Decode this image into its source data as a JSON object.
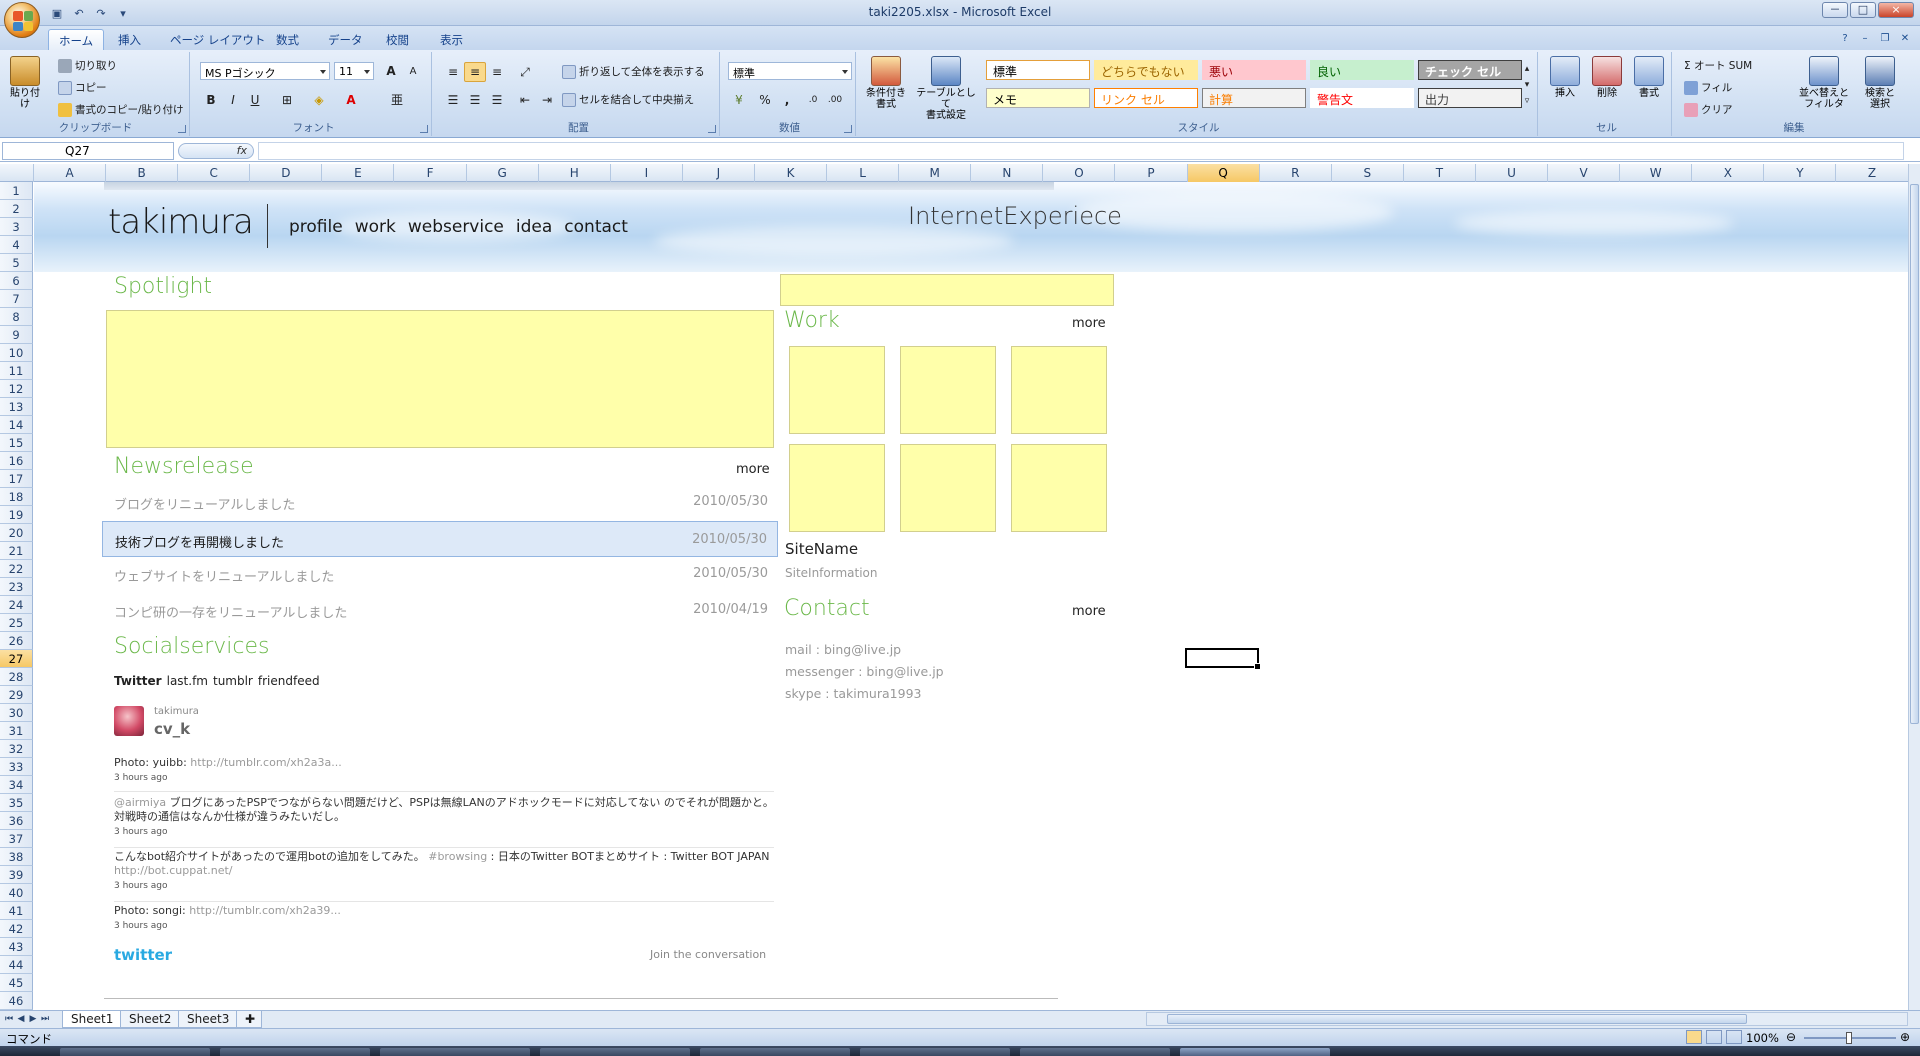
{
  "window": {
    "title": "taki2205.xlsx - Microsoft Excel",
    "controls": [
      "－",
      "□",
      "×"
    ]
  },
  "qat": {
    "save_icon": "save-icon",
    "undo_icon": "undo-icon",
    "redo_icon": "redo-icon"
  },
  "ribbon_tabs": [
    "ホーム",
    "挿入",
    "ページ レイアウト",
    "数式",
    "データ",
    "校閲",
    "表示"
  ],
  "ribbon": {
    "clipboard": {
      "label": "クリップボード",
      "paste": "貼り付け",
      "cut": "切り取り",
      "copy": "コピー",
      "format_painter": "書式のコピー/貼り付け"
    },
    "font": {
      "label": "フォント",
      "font_name": "MS Pゴシック",
      "font_size": "11",
      "bold": "B",
      "italic": "I",
      "underline": "U",
      "grow": "A",
      "shrink": "A",
      "color_letter": "A"
    },
    "alignment": {
      "label": "配置",
      "wrap": "折り返して全体を表示する",
      "merge": "セルを結合して中央揃え"
    },
    "number": {
      "label": "数値",
      "format": "標準",
      "percent": "%",
      "comma": ","
    },
    "styles": {
      "label": "スタイル",
      "conditional": "条件付き\n書式",
      "table": "テーブルとして\n書式設定",
      "cells": [
        {
          "text": "標準",
          "bg": "#ffffff",
          "fg": "#000000",
          "border": "#e49f3a"
        },
        {
          "text": "どちらでもない",
          "bg": "#ffeb9c",
          "fg": "#9c6500",
          "border": "#ffeb9c"
        },
        {
          "text": "悪い",
          "bg": "#ffc7ce",
          "fg": "#9c0006",
          "border": "#ffc7ce"
        },
        {
          "text": "良い",
          "bg": "#c6efce",
          "fg": "#006100",
          "border": "#c6efce"
        },
        {
          "text": "チェック セル",
          "bg": "#a5a5a5",
          "fg": "#ffffff",
          "border": "#3f3f3f"
        },
        {
          "text": "メモ",
          "bg": "#ffffcc",
          "fg": "#000000",
          "border": "#b2b2b2"
        },
        {
          "text": "リンク セル",
          "bg": "#ffffff",
          "fg": "#fa7d00",
          "border": "#ff8001"
        },
        {
          "text": "計算",
          "bg": "#f2f2f2",
          "fg": "#fa7d00",
          "border": "#7f7f7f"
        },
        {
          "text": "警告文",
          "bg": "#ffffff",
          "fg": "#ff0000",
          "border": "#ffffff"
        },
        {
          "text": "出力",
          "bg": "#f2f2f2",
          "fg": "#3f3f3f",
          "border": "#3f3f3f"
        }
      ]
    },
    "cells": {
      "label": "セル",
      "insert": "挿入",
      "delete": "削除",
      "format": "書式"
    },
    "editing": {
      "label": "編集",
      "autosum": "Σ オート SUM",
      "fill": "フィル",
      "clear": "クリア",
      "sort": "並べ替えと\nフィルタ",
      "find": "検索と\n選択"
    }
  },
  "formula_bar": {
    "name_box": "Q27",
    "fx": "fx",
    "value": ""
  },
  "columns": [
    "A",
    "B",
    "C",
    "D",
    "E",
    "F",
    "G",
    "H",
    "I",
    "J",
    "K",
    "L",
    "M",
    "N",
    "O",
    "P",
    "Q",
    "R",
    "S",
    "T",
    "U",
    "V",
    "W",
    "X",
    "Y",
    "Z"
  ],
  "selected_column": "Q",
  "rows": [
    "1",
    "2",
    "3",
    "4",
    "5",
    "6",
    "7",
    "8",
    "9",
    "10",
    "11",
    "12",
    "13",
    "14",
    "15",
    "16",
    "17",
    "18",
    "19",
    "20",
    "21",
    "22",
    "23",
    "24",
    "25",
    "26",
    "27",
    "28",
    "29",
    "30",
    "31",
    "32",
    "33",
    "34",
    "35",
    "36",
    "37",
    "38",
    "39",
    "40",
    "41",
    "42",
    "43",
    "44",
    "45",
    "46"
  ],
  "selected_row": "27",
  "site": {
    "logo": "takimura",
    "nav": [
      "profile",
      "work",
      "webservice",
      "idea",
      "contact"
    ],
    "header_right": "InternetExperiece",
    "spotlight": {
      "title": "Spotlight"
    },
    "newsrelease": {
      "title": "Newsrelease",
      "more": "more",
      "items": [
        {
          "title": "ブログをリニューアルしました",
          "date": "2010/05/30"
        },
        {
          "title": "技術ブログを再開機しました",
          "date": "2010/05/30"
        },
        {
          "title": "ウェブサイトをリニューアルしました",
          "date": "2010/05/30"
        },
        {
          "title": "コンピ研の一存をリニューアルしました",
          "date": "2010/04/19"
        }
      ]
    },
    "social": {
      "title": "Socialservices",
      "tabs": [
        "Twitter",
        "last.fm",
        "tumblr",
        "friendfeed"
      ],
      "user_small": "takimura",
      "user_name": "cv_k",
      "tweets": [
        {
          "text": "Photo: yuibb: ",
          "link": "http://tumblr.com/xh2a3a...",
          "time": "3 hours ago"
        },
        {
          "mention": "@airmiya",
          "text": " ブログにあったPSPでつながらない問題だけど、PSPは無線LANのアドホックモードに対応してない のでそれが問題かと。対戦時の通信はなんか仕様が違うみたいだし。",
          "time": "3 hours ago"
        },
        {
          "text": "こんなbot紹介サイトがあったので運用botの追加をしてみた。",
          "hashtag": " #browsing",
          "text2": " : 日本のTwitter BOTまとめサイト : Twitter BOT JAPAN ",
          "link": "http://bot.cuppat.net/",
          "time": "3 hours ago"
        },
        {
          "text": "Photo: songi: ",
          "link": "http://tumblr.com/xh2a39...",
          "time": "3 hours ago"
        }
      ],
      "footer_logo": "twitter",
      "join": "Join the conversation"
    },
    "work": {
      "title": "Work",
      "more": "more",
      "site_name": "SiteName",
      "site_info": "SiteInformation"
    },
    "contact": {
      "title": "Contact",
      "more": "more",
      "lines": [
        "mail : bing@live.jp",
        "messenger : bing@live.jp",
        "skype : takimura1993"
      ]
    }
  },
  "sheets": [
    "Sheet1",
    "Sheet2",
    "Sheet3"
  ],
  "active_sheet": "Sheet1",
  "status": {
    "mode": "コマンド",
    "zoom": "100%"
  }
}
